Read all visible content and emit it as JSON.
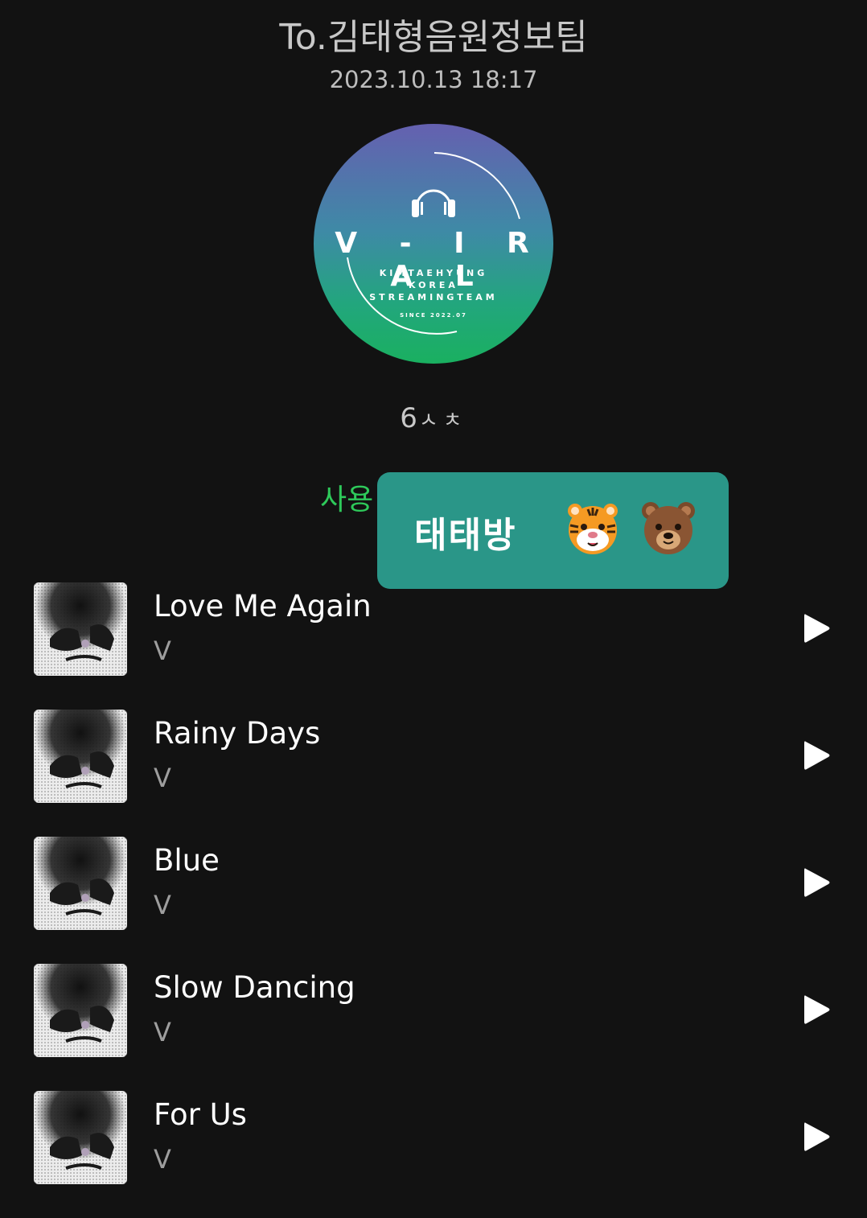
{
  "header": {
    "title": "To.김태형음원정보팀",
    "timestamp": "2023.10.13 18:17"
  },
  "logo": {
    "brand": "V - I R A L",
    "subtitle_line1": "KIMTAEHYUNG",
    "subtitle_line2": "KOREA",
    "subtitle_line3": "STREAMINGTEAM",
    "since": "SINCE 2022.07"
  },
  "members": {
    "count": "6",
    "suffix": "ㅅㅊ"
  },
  "validity": {
    "label": "사용 유효기간 l  -"
  },
  "room_badge": {
    "name": "태태방",
    "emojis": [
      "tiger-face",
      "bear-face"
    ],
    "color": "#2a9688"
  },
  "tracks": [
    {
      "title": "Love Me Again",
      "artist": "V"
    },
    {
      "title": "Rainy Days",
      "artist": "V"
    },
    {
      "title": "Blue",
      "artist": "V"
    },
    {
      "title": "Slow Dancing",
      "artist": "V"
    },
    {
      "title": "For Us",
      "artist": "V"
    }
  ],
  "colors": {
    "background": "#121212",
    "validity_text": "#2ec95a"
  }
}
